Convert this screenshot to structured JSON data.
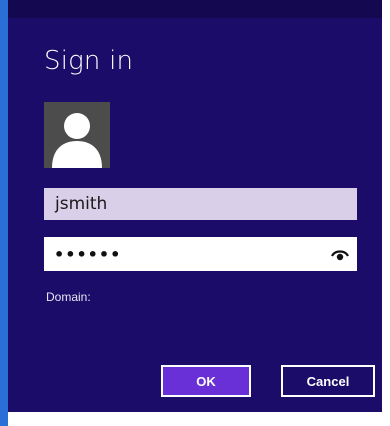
{
  "dialog": {
    "title": "Sign in"
  },
  "avatar": {
    "icon": "user-silhouette-icon"
  },
  "username": {
    "value": "jsmith"
  },
  "password": {
    "masked_value": "••••••",
    "reveal_icon": "eye-icon"
  },
  "domain": {
    "label": "Domain:"
  },
  "buttons": {
    "ok_label": "OK",
    "cancel_label": "Cancel"
  },
  "colors": {
    "dialog_background": "#1c0c6a",
    "accent_strip": "#2a6fd6",
    "primary_button": "#6a30d8",
    "username_field": "#d9cfe8"
  }
}
